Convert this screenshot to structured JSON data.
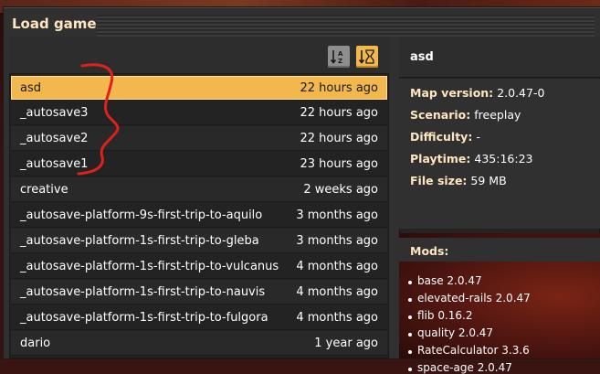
{
  "window": {
    "title": "Load game"
  },
  "sort": {
    "alpha_label": "A/Z",
    "time_label": "⧗"
  },
  "saves": [
    {
      "name": "asd",
      "time": "22 hours ago",
      "selected": true
    },
    {
      "name": "_autosave3",
      "time": "22 hours ago"
    },
    {
      "name": "_autosave2",
      "time": "22 hours ago"
    },
    {
      "name": "_autosave1",
      "time": "23 hours ago"
    },
    {
      "name": "creative",
      "time": "2 weeks ago"
    },
    {
      "name": "_autosave-platform-9s-first-trip-to-aquilo",
      "time": "3 months ago"
    },
    {
      "name": "_autosave-platform-1s-first-trip-to-gleba",
      "time": "3 months ago"
    },
    {
      "name": "_autosave-platform-1s-first-trip-to-vulcanus",
      "time": "4 months ago"
    },
    {
      "name": "_autosave-platform-1s-first-trip-to-nauvis",
      "time": "4 months ago"
    },
    {
      "name": "_autosave-platform-1s-first-trip-to-fulgora",
      "time": "4 months ago"
    },
    {
      "name": "dario",
      "time": "1 year ago"
    }
  ],
  "details": {
    "title": "asd",
    "map_version_label": "Map version:",
    "map_version": "2.0.47-0",
    "scenario_label": "Scenario:",
    "scenario": "freeplay",
    "difficulty_label": "Difficulty:",
    "difficulty": "-",
    "playtime_label": "Playtime:",
    "playtime": "435:16:23",
    "filesize_label": "File size:",
    "filesize": "59 MB"
  },
  "mods": {
    "header": "Mods:",
    "items": [
      "base 2.0.47",
      "elevated-rails 2.0.47",
      "flib 0.16.2",
      "quality 2.0.47",
      "RateCalculator 3.3.6",
      "space-age 2.0.47"
    ]
  },
  "colors": {
    "accent": "#f2b84d",
    "annotation": "#e0201a"
  }
}
